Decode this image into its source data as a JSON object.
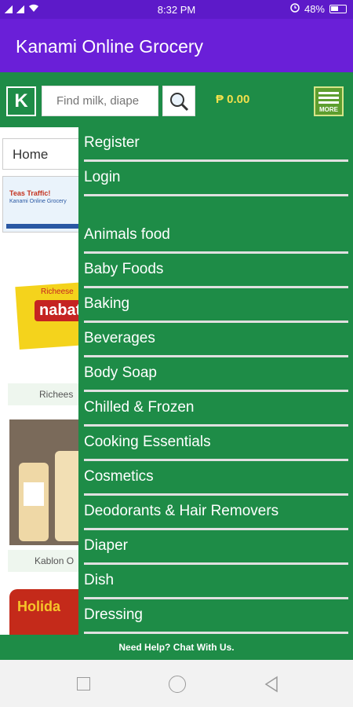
{
  "status": {
    "time": "8:32 PM",
    "battery": "48%"
  },
  "app": {
    "title": "Kanami Online Grocery"
  },
  "toolbar": {
    "logo_letter": "K",
    "search_placeholder": "Find milk, diape",
    "cart_amount": "₱ 0.00",
    "more_label": "MORE"
  },
  "content": {
    "home_select": "Home",
    "banner_title": "Teas Traffic!",
    "banner_sub": "Kanami Online Grocery",
    "product_1_brand": "nabati",
    "product_1_small": "Richeese",
    "product_1_label": "Richees",
    "product_2_label": "Kablon O",
    "product_3_brand": "Holida"
  },
  "drawer": {
    "items": [
      {
        "label": "Register"
      },
      {
        "label": "Login"
      },
      {
        "label": "Animals food"
      },
      {
        "label": "Baby Foods"
      },
      {
        "label": "Baking"
      },
      {
        "label": "Beverages"
      },
      {
        "label": "Body Soap"
      },
      {
        "label": "Chilled & Frozen"
      },
      {
        "label": "Cooking Essentials"
      },
      {
        "label": "Cosmetics"
      },
      {
        "label": "Deodorants & Hair Removers"
      },
      {
        "label": "Diaper"
      },
      {
        "label": "Dish"
      },
      {
        "label": "Dressing"
      }
    ]
  },
  "footer": {
    "help_text": "Need Help? Chat With Us."
  }
}
